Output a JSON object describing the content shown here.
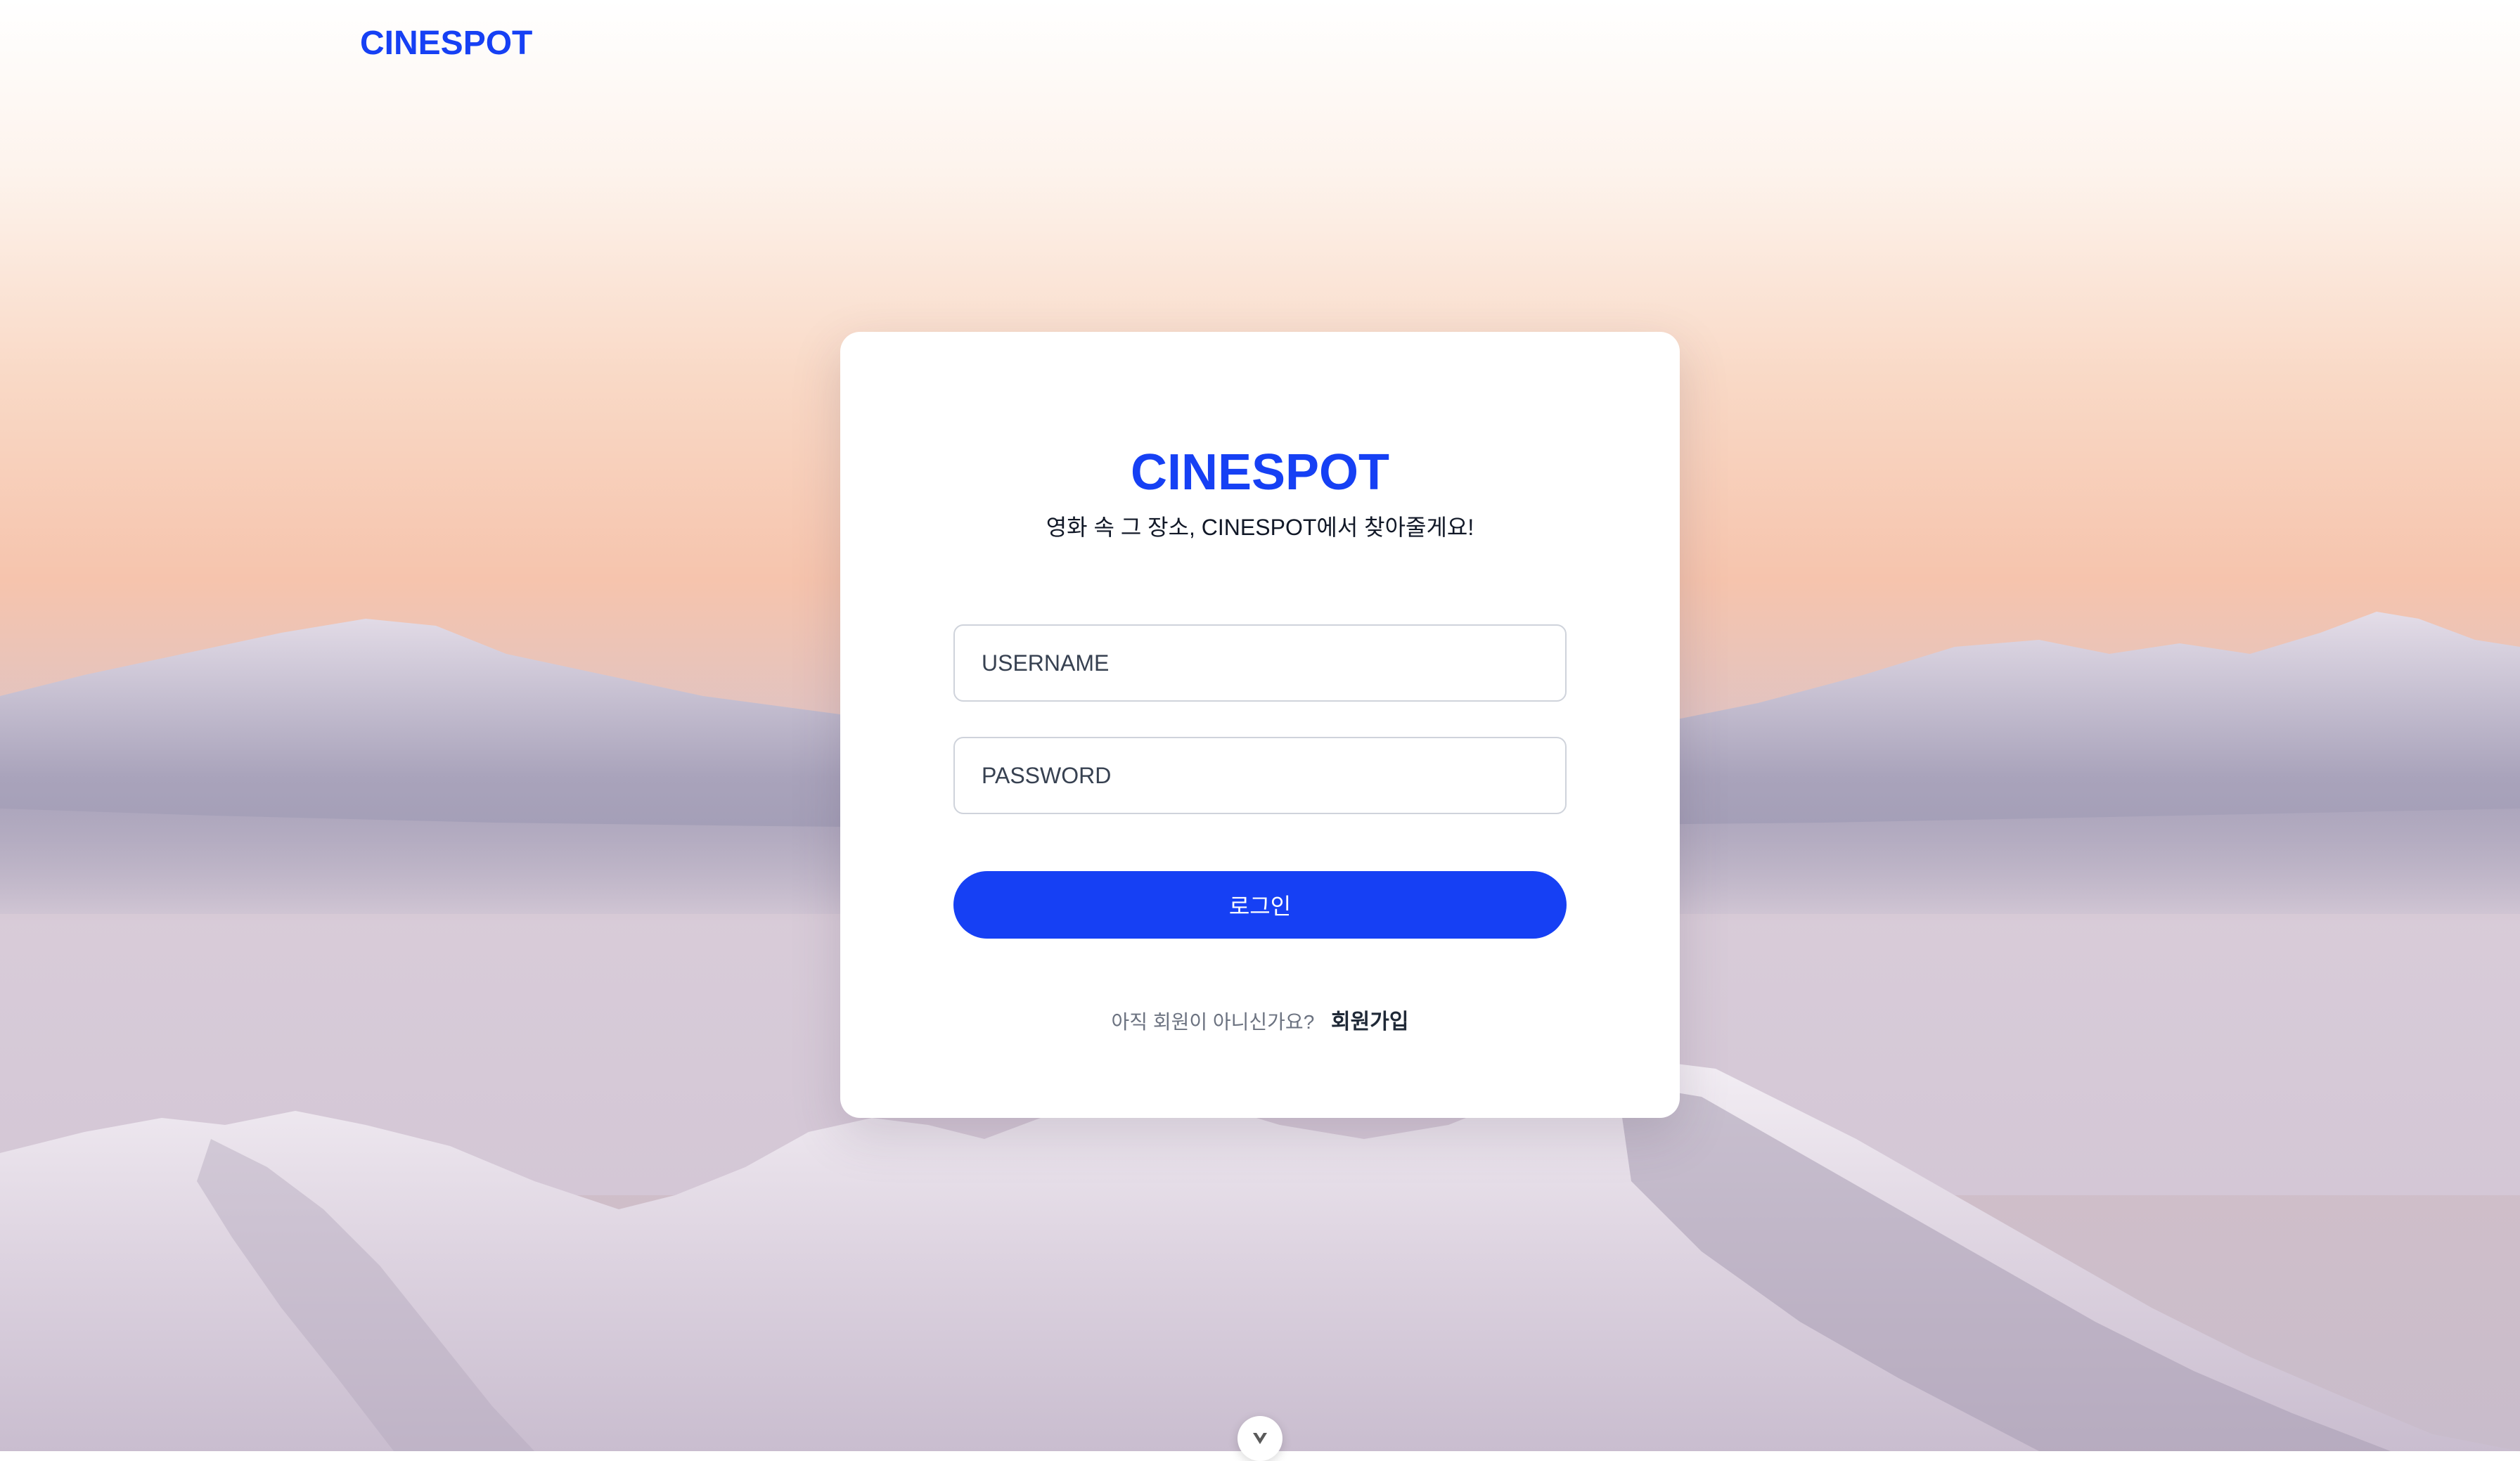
{
  "header": {
    "brand": "CINESPOT"
  },
  "login": {
    "title": "CINESPOT",
    "subtitle": "영화 속 그 장소, CINESPOT에서 찾아줄게요!",
    "username_placeholder": "USERNAME",
    "password_placeholder": "PASSWORD",
    "submit_label": "로그인",
    "signup_prompt": "아직 회원이 아니신가요?",
    "signup_link": "회원가입"
  },
  "colors": {
    "accent": "#1640f4",
    "card_background": "#ffffff"
  },
  "icons": {
    "scroll_toggle": "chevron-down-icon"
  }
}
